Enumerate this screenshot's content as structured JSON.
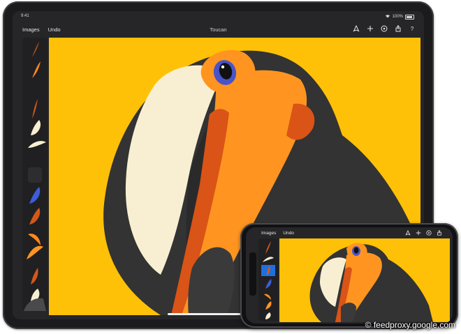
{
  "tablet": {
    "status": {
      "time": "9:41",
      "battery": "100%"
    },
    "toolbar": {
      "images_label": "Images",
      "undo_label": "Undo",
      "title": "Toucan",
      "icons": [
        "pen-nib-icon",
        "plus-icon",
        "compass-icon",
        "share-icon",
        "help-icon"
      ],
      "help_label": "?"
    },
    "brush_sidebar": {
      "items": [
        "brush-stroke",
        "brush-stroke",
        "brush-stroke",
        "brush-stroke",
        "brush-stroke",
        "brush-stroke",
        "brush-stroke",
        "brush-stroke",
        "brush-stroke",
        "brush-stroke",
        "brush-stroke",
        "brush-stroke"
      ]
    }
  },
  "phone": {
    "toolbar": {
      "images_label": "Images",
      "undo_label": "Undo",
      "icons": [
        "pen-nib-icon",
        "plus-icon",
        "compass-icon",
        "share-icon"
      ]
    }
  },
  "colors": {
    "canvas_bg": "#ffc107",
    "toucan_black": "#333333",
    "toucan_white": "#f8efd2",
    "beak_orange": "#ff9520",
    "beak_dark": "#d95416",
    "eye_blue": "#4a54c8",
    "selected": "#1e6fe0"
  },
  "watermark": "© feedproxy.google.com"
}
